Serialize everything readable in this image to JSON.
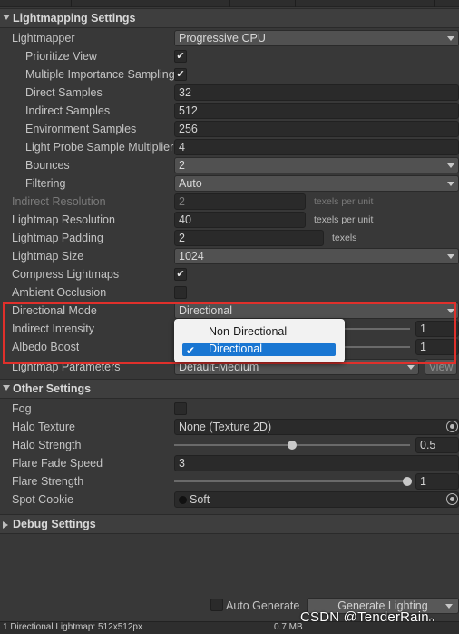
{
  "lightmapping": {
    "title": "Lightmapping Settings",
    "lightmapper": {
      "label": "Lightmapper",
      "value": "Progressive CPU"
    },
    "prioritize_view": {
      "label": "Prioritize View",
      "checked": true
    },
    "multiple_importance_sampling": {
      "label": "Multiple Importance Sampling",
      "checked": true
    },
    "direct_samples": {
      "label": "Direct Samples",
      "value": "32"
    },
    "indirect_samples": {
      "label": "Indirect Samples",
      "value": "512"
    },
    "environment_samples": {
      "label": "Environment Samples",
      "value": "256"
    },
    "light_probe_sample_multiplier": {
      "label": "Light Probe Sample Multiplier",
      "value": "4"
    },
    "bounces": {
      "label": "Bounces",
      "value": "2"
    },
    "filtering": {
      "label": "Filtering",
      "value": "Auto"
    },
    "indirect_resolution": {
      "label": "Indirect Resolution",
      "value": "2",
      "suffix": "texels per unit"
    },
    "lightmap_resolution": {
      "label": "Lightmap Resolution",
      "value": "40",
      "suffix": "texels per unit"
    },
    "lightmap_padding": {
      "label": "Lightmap Padding",
      "value": "2",
      "suffix": "texels"
    },
    "lightmap_size": {
      "label": "Lightmap Size",
      "value": "1024"
    },
    "compress_lightmaps": {
      "label": "Compress Lightmaps",
      "checked": true
    },
    "ambient_occlusion": {
      "label": "Ambient Occlusion",
      "checked": false
    },
    "directional_mode": {
      "label": "Directional Mode",
      "value": "Directional"
    },
    "indirect_intensity": {
      "label": "Indirect Intensity",
      "value": "1"
    },
    "albedo_boost": {
      "label": "Albedo Boost",
      "value": "1"
    },
    "lightmap_parameters": {
      "label": "Lightmap Parameters",
      "value": "Default-Medium",
      "view_button": "View"
    }
  },
  "directional_popup": {
    "options": [
      "Non-Directional",
      "Directional"
    ],
    "selected": "Directional",
    "check": "✔"
  },
  "other": {
    "title": "Other Settings",
    "fog": {
      "label": "Fog",
      "checked": false
    },
    "halo_texture": {
      "label": "Halo Texture",
      "value": "None (Texture 2D)"
    },
    "halo_strength": {
      "label": "Halo Strength",
      "value": "0.5"
    },
    "flare_fade_speed": {
      "label": "Flare Fade Speed",
      "value": "3"
    },
    "flare_strength": {
      "label": "Flare Strength",
      "value": "1"
    },
    "spot_cookie": {
      "label": "Spot Cookie",
      "value": "Soft"
    }
  },
  "debug": {
    "title": "Debug Settings"
  },
  "footer": {
    "auto_generate": {
      "label": "Auto Generate",
      "checked": false
    },
    "generate_button": "Generate Lighting"
  },
  "status": {
    "left": "1 Directional Lightmap: 512x512px",
    "right": "0.7 MB"
  },
  "watermark": "CSDN @TenderRain。",
  "colors": {
    "panel": "#383838",
    "highlight_box": "#e0302b",
    "selection": "#1976d2"
  }
}
